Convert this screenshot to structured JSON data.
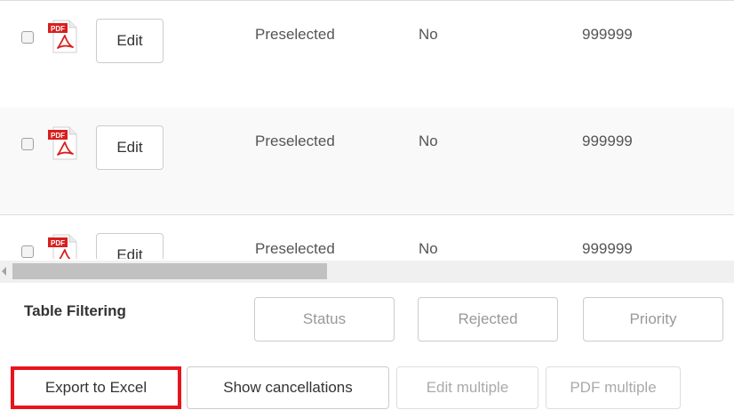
{
  "colors": {
    "highlight": "#e8141c",
    "pdf_red": "#d8201e",
    "row_border": "#dddddd",
    "scrollbar_thumb": "#c1c1c1"
  },
  "table": {
    "rows": [
      {
        "icon": "pdf-file-icon",
        "edit_label": "Edit",
        "status": "Preselected",
        "rejected": "No",
        "priority": "999999"
      },
      {
        "icon": "pdf-file-icon",
        "edit_label": "Edit",
        "status": "Preselected",
        "rejected": "No",
        "priority": "999999"
      },
      {
        "icon": "pdf-file-icon",
        "edit_label": "Edit",
        "status": "Preselected",
        "rejected": "No",
        "priority": "999999"
      }
    ],
    "pdf_badge": "PDF"
  },
  "filtering": {
    "title": "Table Filtering",
    "status_placeholder": "Status",
    "rejected_placeholder": "Rejected",
    "priority_placeholder": "Priority"
  },
  "actions": {
    "export_label": "Export to Excel",
    "cancellations_label": "Show cancellations",
    "edit_multiple_label": "Edit multiple",
    "pdf_multiple_label": "PDF multiple"
  }
}
